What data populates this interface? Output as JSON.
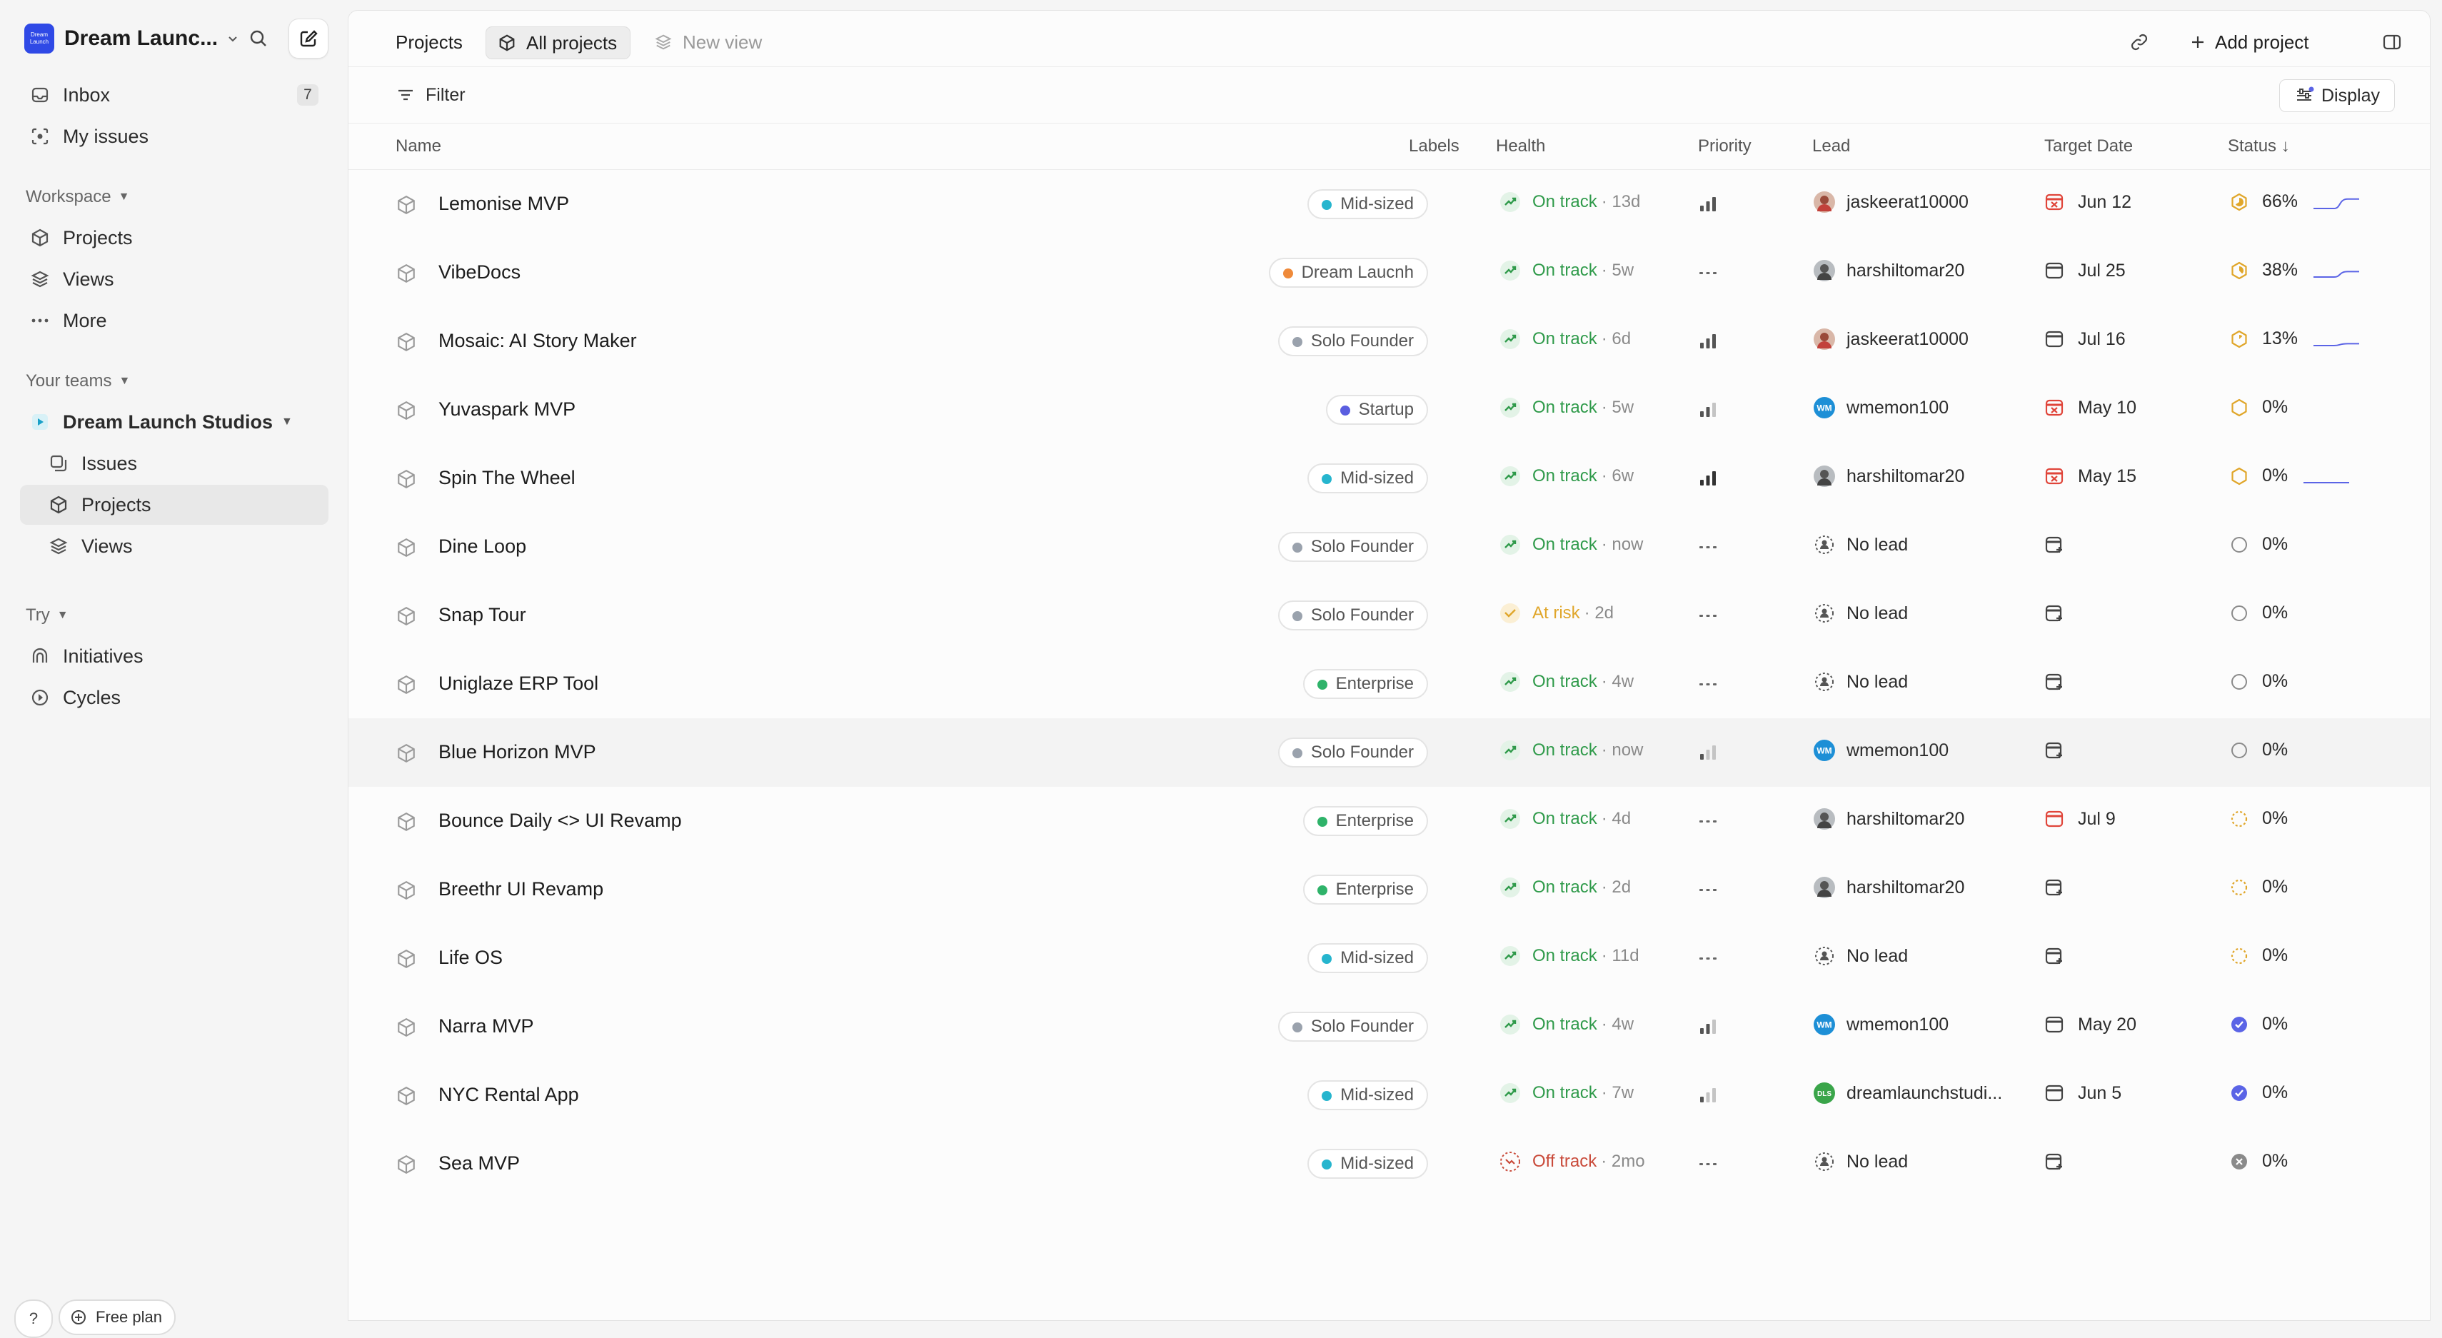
{
  "workspace": {
    "name": "Dream Launc...",
    "logo_text": "Dream Launch"
  },
  "sidebar": {
    "inbox": {
      "label": "Inbox",
      "count": "7"
    },
    "my_issues": "My issues",
    "workspace_label": "Workspace",
    "workspace_items": [
      "Projects",
      "Views",
      "More"
    ],
    "teams_label": "Your teams",
    "team_name": "Dream Launch Studios",
    "team_items": [
      "Issues",
      "Projects",
      "Views"
    ],
    "try_label": "Try",
    "try_items": [
      "Initiatives",
      "Cycles"
    ],
    "help_label": "?",
    "plan_label": "Free plan"
  },
  "header": {
    "title": "Projects",
    "active_view": "All projects",
    "new_view": "New view",
    "add_project": "Add project"
  },
  "toolbar": {
    "filter": "Filter",
    "display": "Display"
  },
  "columns": {
    "name": "Name",
    "labels": "Labels",
    "health": "Health",
    "priority": "Priority",
    "lead": "Lead",
    "target_date": "Target Date",
    "status": "Status ↓"
  },
  "colors": {
    "on_track": "#2f9a4a",
    "at_risk": "#e0a62a",
    "off_track": "#c94a3a",
    "label_midsized": "#26b5ce",
    "label_dream": "#ef8a3a",
    "label_solo": "#9aa2ad",
    "label_startup": "#5a5ee0",
    "label_enterprise": "#2fb36a",
    "accent": "#5b64e6"
  },
  "projects": [
    {
      "name": "Lemonise MVP",
      "label": "Mid-sized",
      "label_color": "#26b5ce",
      "health": "On track",
      "health_age": "· 13d",
      "health_state": "on",
      "priority": "high",
      "lead": "jaskeerat10000",
      "lead_avatar": "photo-red",
      "date": "Jun 12",
      "date_state": "overdue",
      "status": "66%",
      "status_icon": "progress",
      "progress": 0.66,
      "spark": true
    },
    {
      "name": "VibeDocs",
      "label": "Dream Laucnh",
      "label_color": "#ef8a3a",
      "health": "On track",
      "health_age": "· 5w",
      "health_state": "on",
      "priority": "none",
      "lead": "harshiltomar20",
      "lead_avatar": "photo-gray",
      "date": "Jul 25",
      "date_state": "normal",
      "status": "38%",
      "status_icon": "progress",
      "progress": 0.38,
      "spark": true
    },
    {
      "name": "Mosaic: AI Story Maker",
      "label": "Solo Founder",
      "label_color": "#9aa2ad",
      "health": "On track",
      "health_age": "· 6d",
      "health_state": "on",
      "priority": "high",
      "lead": "jaskeerat10000",
      "lead_avatar": "photo-red",
      "date": "Jul 16",
      "date_state": "normal",
      "status": "13%",
      "status_icon": "progress",
      "progress": 0.13,
      "spark": true
    },
    {
      "name": "Yuvaspark MVP",
      "label": "Startup",
      "label_color": "#5a5ee0",
      "health": "On track",
      "health_age": "· 5w",
      "health_state": "on",
      "priority": "medium",
      "lead": "wmemon100",
      "lead_avatar": "wm",
      "date": "May 10",
      "date_state": "overdue",
      "status": "0%",
      "status_icon": "progress",
      "progress": 0,
      "spark": false
    },
    {
      "name": "Spin The Wheel",
      "label": "Mid-sized",
      "label_color": "#26b5ce",
      "health": "On track",
      "health_age": "· 6w",
      "health_state": "on",
      "priority": "urgent",
      "lead": "harshiltomar20",
      "lead_avatar": "photo-gray",
      "date": "May 15",
      "date_state": "overdue",
      "status": "0%",
      "status_icon": "progress",
      "progress": 0,
      "spark": true
    },
    {
      "name": "Dine Loop",
      "label": "Solo Founder",
      "label_color": "#9aa2ad",
      "health": "On track",
      "health_age": "· now",
      "health_state": "on",
      "priority": "none",
      "lead": "No lead",
      "lead_avatar": "none",
      "date": "",
      "date_state": "empty",
      "status": "0%",
      "status_icon": "backlog",
      "progress": 0,
      "spark": false
    },
    {
      "name": "Snap Tour",
      "label": "Solo Founder",
      "label_color": "#9aa2ad",
      "health": "At risk",
      "health_age": "· 2d",
      "health_state": "risk",
      "priority": "none",
      "lead": "No lead",
      "lead_avatar": "none",
      "date": "",
      "date_state": "empty",
      "status": "0%",
      "status_icon": "backlog",
      "progress": 0,
      "spark": false
    },
    {
      "name": "Uniglaze ERP Tool",
      "label": "Enterprise",
      "label_color": "#2fb36a",
      "health": "On track",
      "health_age": "· 4w",
      "health_state": "on",
      "priority": "none",
      "lead": "No lead",
      "lead_avatar": "none",
      "date": "",
      "date_state": "empty",
      "status": "0%",
      "status_icon": "backlog",
      "progress": 0,
      "spark": false
    },
    {
      "name": "Blue Horizon MVP",
      "label": "Solo Founder",
      "label_color": "#9aa2ad",
      "health": "On track",
      "health_age": "· now",
      "health_state": "on",
      "priority": "low",
      "lead": "wmemon100",
      "lead_avatar": "wm",
      "date": "",
      "date_state": "empty",
      "status": "0%",
      "status_icon": "backlog",
      "progress": 0,
      "spark": false
    },
    {
      "name": "Bounce Daily <> UI Revamp",
      "label": "Enterprise",
      "label_color": "#2fb36a",
      "health": "On track",
      "health_age": "· 4d",
      "health_state": "on",
      "priority": "none",
      "lead": "harshiltomar20",
      "lead_avatar": "photo-gray",
      "date": "Jul 9",
      "date_state": "soon",
      "status": "0%",
      "status_icon": "planned",
      "progress": 0,
      "spark": false
    },
    {
      "name": "Breethr UI Revamp",
      "label": "Enterprise",
      "label_color": "#2fb36a",
      "health": "On track",
      "health_age": "· 2d",
      "health_state": "on",
      "priority": "none",
      "lead": "harshiltomar20",
      "lead_avatar": "photo-gray",
      "date": "",
      "date_state": "empty",
      "status": "0%",
      "status_icon": "planned",
      "progress": 0,
      "spark": false
    },
    {
      "name": "Life OS",
      "label": "Mid-sized",
      "label_color": "#26b5ce",
      "health": "On track",
      "health_age": "· 11d",
      "health_state": "on",
      "priority": "none",
      "lead": "No lead",
      "lead_avatar": "none",
      "date": "",
      "date_state": "empty",
      "status": "0%",
      "status_icon": "planned",
      "progress": 0,
      "spark": false
    },
    {
      "name": "Narra MVP",
      "label": "Solo Founder",
      "label_color": "#9aa2ad",
      "health": "On track",
      "health_age": "· 4w",
      "health_state": "on",
      "priority": "medium",
      "lead": "wmemon100",
      "lead_avatar": "wm",
      "date": "May 20",
      "date_state": "normal",
      "status": "0%",
      "status_icon": "done",
      "progress": 0,
      "spark": false
    },
    {
      "name": "NYC Rental App",
      "label": "Mid-sized",
      "label_color": "#26b5ce",
      "health": "On track",
      "health_age": "· 7w",
      "health_state": "on",
      "priority": "low",
      "lead": "dreamlaunchstudi...",
      "lead_avatar": "dls",
      "date": "Jun 5",
      "date_state": "normal",
      "status": "0%",
      "status_icon": "done",
      "progress": 0,
      "spark": false
    },
    {
      "name": "Sea MVP",
      "label": "Mid-sized",
      "label_color": "#26b5ce",
      "health": "Off track",
      "health_age": "· 2mo",
      "health_state": "off",
      "priority": "none",
      "lead": "No lead",
      "lead_avatar": "none",
      "date": "",
      "date_state": "empty",
      "status": "0%",
      "status_icon": "canceled",
      "progress": 0,
      "spark": false
    }
  ]
}
